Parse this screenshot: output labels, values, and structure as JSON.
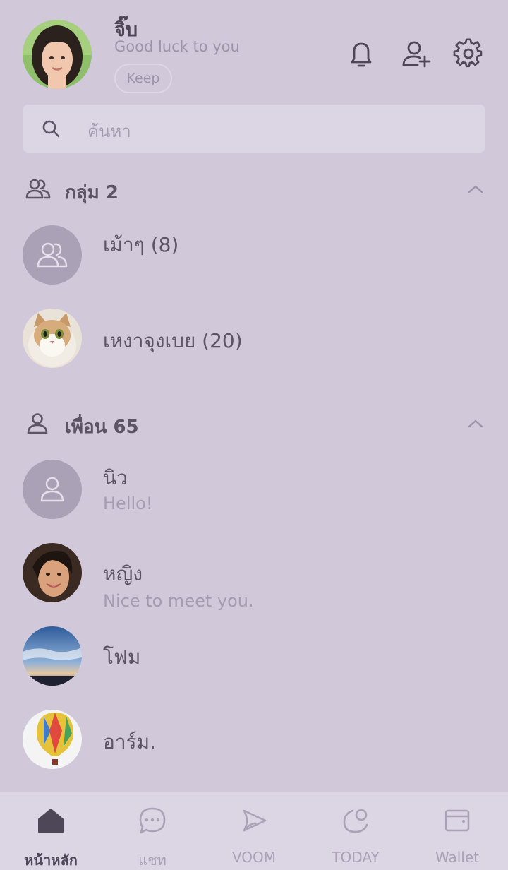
{
  "profile": {
    "name": "จิ๊บ",
    "status": "Good luck to you",
    "keep_label": "Keep"
  },
  "search": {
    "placeholder": "ค้นหา"
  },
  "groups": {
    "title": "กลุ่ม 2",
    "items": [
      {
        "name": "เม้าๆ (8)"
      },
      {
        "name": "เหงาจุงเบย (20)"
      }
    ]
  },
  "friends": {
    "title": "เพื่อน 65",
    "items": [
      {
        "name": "นิว",
        "message": "Hello!"
      },
      {
        "name": "หญิง",
        "message": "Nice to meet you."
      },
      {
        "name": "โฟม"
      },
      {
        "name": "อาร์ม."
      }
    ]
  },
  "nav": [
    {
      "label": "หน้าหลัก",
      "icon": "home-icon",
      "active": true
    },
    {
      "label": "แชท",
      "icon": "chat-icon"
    },
    {
      "label": "VOOM",
      "icon": "voom-icon"
    },
    {
      "label": "TODAY",
      "icon": "today-icon"
    },
    {
      "label": "Wallet",
      "icon": "wallet-icon"
    }
  ]
}
